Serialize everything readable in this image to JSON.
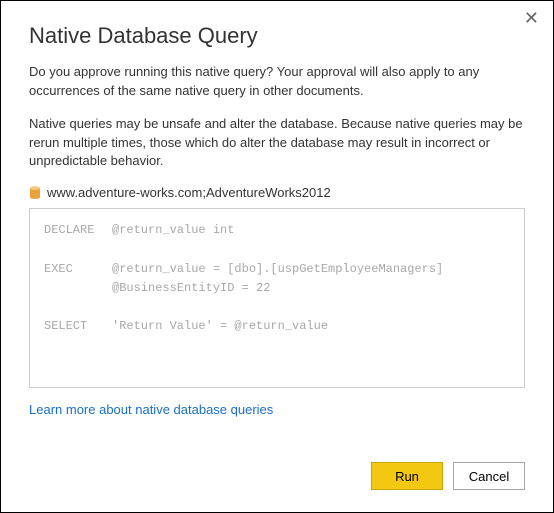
{
  "dialog": {
    "title": "Native Database Query",
    "close_symbol": "✕",
    "paragraph1": "Do you approve running this native query? Your approval will also apply to any occurrences of the same native query in other documents.",
    "paragraph2": "Native queries may be unsafe and alter the database. Because native queries may be rerun multiple times, those which do alter the database may result in incorrect or unpredictable behavior.",
    "database_label": "www.adventure-works.com;AdventureWorks2012",
    "icon_color": "#e8a33d"
  },
  "query": {
    "line1_kw": "DECLARE",
    "line1_rest": "@return_value int",
    "line2_kw": "EXEC",
    "line2_rest": "@return_value = [dbo].[uspGetEmployeeManagers]",
    "line3_indent": "@BusinessEntityID = 22",
    "line4_kw": "SELECT",
    "line4_rest": "'Return Value' = @return_value"
  },
  "link": {
    "learn_more": "Learn more about native database queries"
  },
  "buttons": {
    "run": "Run",
    "cancel": "Cancel"
  }
}
